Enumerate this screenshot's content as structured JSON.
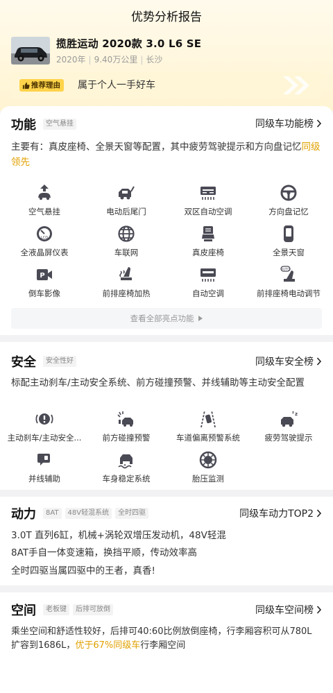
{
  "header": {
    "title": "优势分析报告",
    "car_name": "揽胜运动 2020款 3.0 L6 SE",
    "meta": {
      "year": "2020年",
      "mileage": "9.40万公里",
      "city": "长沙"
    },
    "reason_badge": "推荐理由",
    "reason_text": "属于个人一手好车"
  },
  "function": {
    "title": "功能",
    "tags": [
      "空气悬挂"
    ],
    "rank_label": "同级车功能榜",
    "desc_prefix": "主要有：真皮座椅、全景天窗等配置，其中疲劳驾驶提示和方向盘记忆",
    "desc_highlight": "同级领先",
    "features": [
      {
        "label": "空气悬挂",
        "icon": "air-suspension-icon"
      },
      {
        "label": "电动后尾门",
        "icon": "power-tailgate-icon"
      },
      {
        "label": "双区自动空调",
        "icon": "dual-zone-ac-icon"
      },
      {
        "label": "方向盘记忆",
        "icon": "steering-memory-icon"
      },
      {
        "label": "全液晶屏仪表",
        "icon": "lcd-cluster-icon"
      },
      {
        "label": "车联网",
        "icon": "connected-car-icon"
      },
      {
        "label": "真皮座椅",
        "icon": "leather-seat-icon"
      },
      {
        "label": "全景天窗",
        "icon": "panoramic-sunroof-icon"
      },
      {
        "label": "倒车影像",
        "icon": "reverse-camera-icon"
      },
      {
        "label": "前排座椅加热",
        "icon": "seat-heating-icon"
      },
      {
        "label": "自动空调",
        "icon": "auto-ac-icon"
      },
      {
        "label": "前排座椅电动调节",
        "icon": "power-seat-icon"
      }
    ],
    "view_all": "查看全部亮点功能"
  },
  "safety": {
    "title": "安全",
    "tags": [
      "安全性好"
    ],
    "rank_label": "同级车安全榜",
    "desc": "标配主动刹车/主动安全系统、前方碰撞预警、并线辅助等主动安全配置",
    "features": [
      {
        "label": "主动刹车/主动安全...",
        "icon": "active-brake-icon"
      },
      {
        "label": "前方碰撞预警",
        "icon": "collision-warning-icon"
      },
      {
        "label": "车道偏离预警系统",
        "icon": "lane-departure-icon"
      },
      {
        "label": "疲劳驾驶提示",
        "icon": "fatigue-alert-icon"
      },
      {
        "label": "并线辅助",
        "icon": "blind-spot-icon"
      },
      {
        "label": "车身稳定系统",
        "icon": "stability-control-icon"
      },
      {
        "label": "胎压监测",
        "icon": "tire-pressure-icon"
      }
    ]
  },
  "power": {
    "title": "动力",
    "tags": [
      "8AT",
      "48V轻混系统",
      "全时四驱"
    ],
    "rank_label": "同级车动力TOP2",
    "lines": [
      "3.0T 直列6缸，机械+涡轮双增压发动机，48V轻混",
      "8AT手自一体变速箱，换挡平顺，传动效率高",
      "全时四驱当属四驱中的王者，真香!"
    ]
  },
  "space": {
    "title": "空间",
    "tags": [
      "老板键",
      "后排可放倒"
    ],
    "rank_label": "同级车空间榜",
    "desc_line1": "乘坐空间和舒适性较好，后排可40:60比例放倒座椅，行李厢容积可从780L",
    "desc_line2_prefix": "扩容到1686L，",
    "desc_line2_highlight": "优于67%同级车",
    "desc_line2_suffix": "行李厢空间"
  },
  "colors": {
    "accent": "#e0a100",
    "badge": "#ffd34a",
    "icon": "#4a4a55"
  }
}
